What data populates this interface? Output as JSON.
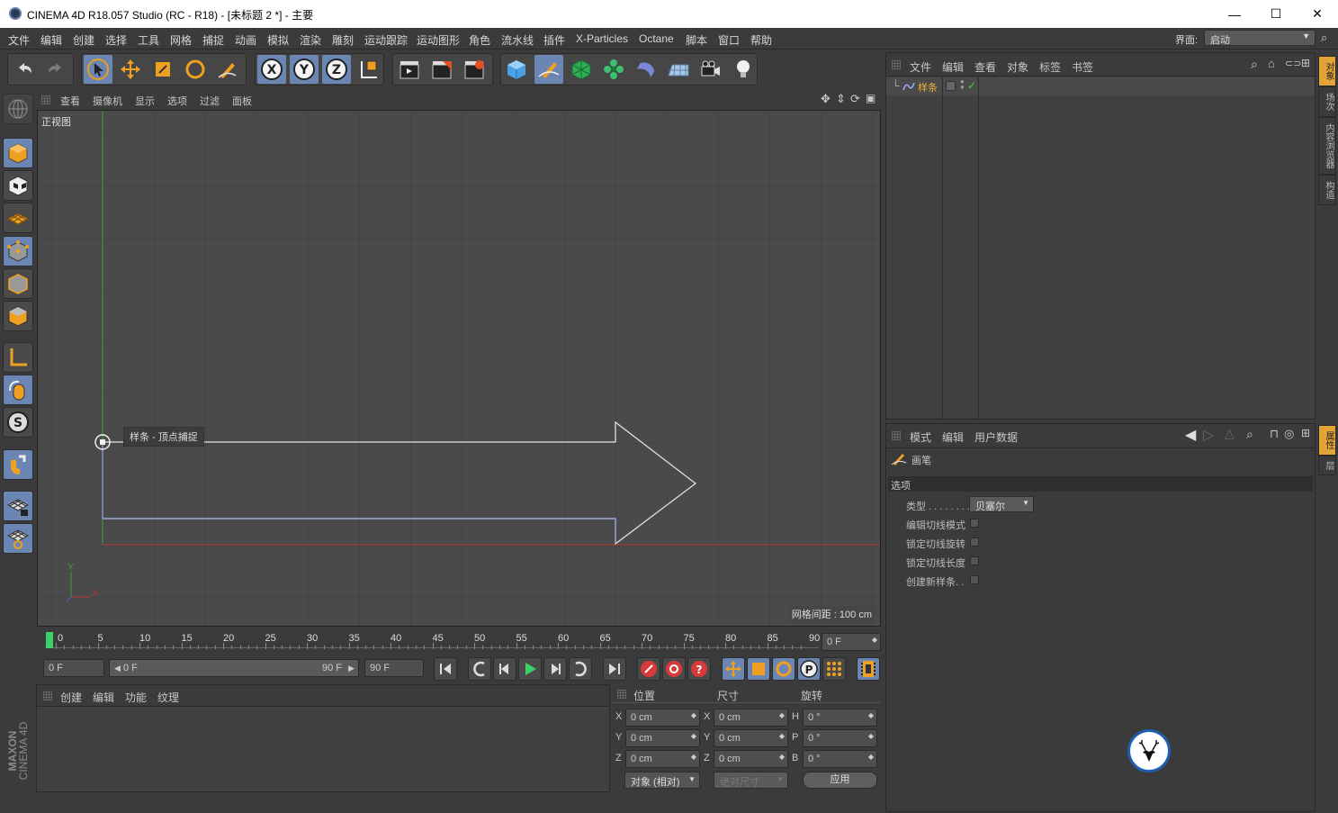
{
  "window": {
    "title": "CINEMA 4D R18.057 Studio (RC - R18) - [未标题 2 *] - 主要",
    "minimize": "—",
    "maximize": "☐",
    "close": "✕"
  },
  "menu": {
    "items": [
      "文件",
      "编辑",
      "创建",
      "选择",
      "工具",
      "网格",
      "捕捉",
      "动画",
      "模拟",
      "渲染",
      "雕刻",
      "运动跟踪",
      "运动图形",
      "角色",
      "流水线",
      "插件",
      "X-Particles",
      "Octane",
      "脚本",
      "窗口",
      "帮助"
    ],
    "layout_label": "界面:",
    "layout_value": "启动"
  },
  "viewport": {
    "menu": [
      "查看",
      "摄像机",
      "显示",
      "选项",
      "过滤",
      "面板"
    ],
    "view_name": "正视图",
    "tooltip": "样条 - 顶点捕捉",
    "grid_spacing": "网格间距 : 100 cm",
    "axis_y": "Y",
    "axis_x": "X"
  },
  "timeline": {
    "ticks": [
      "0",
      "5",
      "10",
      "15",
      "20",
      "25",
      "30",
      "35",
      "40",
      "45",
      "50",
      "55",
      "60",
      "65",
      "70",
      "75",
      "80",
      "85",
      "90"
    ],
    "current_frame": "0 F"
  },
  "playbar": {
    "start": "0 F",
    "range_start": "0 F",
    "range_end": "90 F",
    "end": "90 F"
  },
  "materials": {
    "menu": [
      "创建",
      "编辑",
      "功能",
      "纹理"
    ]
  },
  "coords": {
    "headers": [
      "位置",
      "尺寸",
      "旋转"
    ],
    "rows": [
      {
        "axis": "X",
        "pos": "0 cm",
        "size_axis": "X",
        "size": "0 cm",
        "rot_axis": "H",
        "rot": "0 °"
      },
      {
        "axis": "Y",
        "pos": "0 cm",
        "size_axis": "Y",
        "size": "0 cm",
        "rot_axis": "P",
        "rot": "0 °"
      },
      {
        "axis": "Z",
        "pos": "0 cm",
        "size_axis": "Z",
        "size": "0 cm",
        "rot_axis": "B",
        "rot": "0 °"
      }
    ],
    "mode": "对象 (相对)",
    "size_mode": "绝对尺寸",
    "apply": "应用"
  },
  "objects": {
    "menu": [
      "文件",
      "编辑",
      "查看",
      "对象",
      "标签",
      "书签"
    ],
    "items": [
      {
        "name": "样条"
      }
    ]
  },
  "attributes": {
    "menu": [
      "模式",
      "编辑",
      "用户数据"
    ],
    "tool_name": "画笔",
    "section": "选项",
    "type_label": "类型 . . . . . . . .",
    "type_value": "贝塞尔",
    "options": [
      "编辑切线模式",
      "锁定切线旋转",
      "锁定切线长度",
      "创建新样条. ."
    ]
  },
  "right_tabs": [
    "对象",
    "场次",
    "内容浏览器",
    "构造"
  ],
  "right_tabs2": [
    "属性",
    "层"
  ],
  "brand": {
    "line1": "MAXON",
    "line2": "CINEMA 4D"
  },
  "colors": {
    "bg": "#3b3b3b",
    "viewport": "#4a4a4a",
    "accent": "#e2a437",
    "select": "#6b86b3",
    "spline": "#8fa6e0",
    "x_axis": "#c03030",
    "y_axis": "#3ba03b"
  }
}
